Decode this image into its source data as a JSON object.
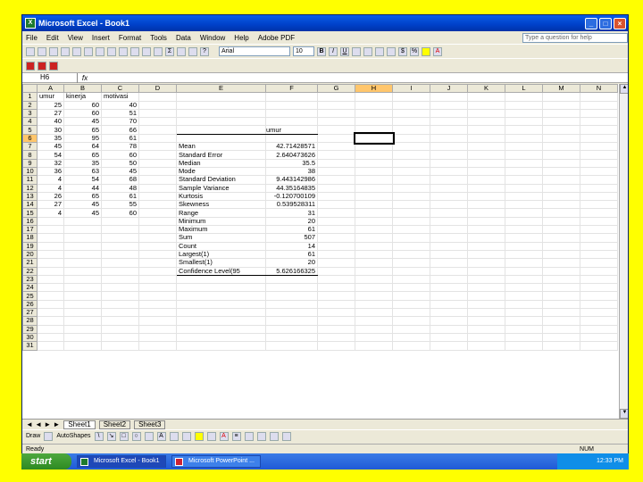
{
  "window": {
    "title": "Microsoft Excel - Book1"
  },
  "menu": [
    "File",
    "Edit",
    "View",
    "Insert",
    "Format",
    "Tools",
    "Data",
    "Window",
    "Help",
    "Adobe PDF"
  ],
  "help_placeholder": "Type a question for help",
  "font": {
    "name": "Arial",
    "size": "10"
  },
  "formula_bar": {
    "name_box": "H6",
    "fx": "fx",
    "value": ""
  },
  "columns": [
    "A",
    "B",
    "C",
    "D",
    "E",
    "F",
    "G",
    "H",
    "I",
    "J",
    "K",
    "L",
    "M",
    "N"
  ],
  "headers_row1": {
    "A": "umur",
    "B": "kinerja",
    "C": "motivasi"
  },
  "rows": [
    {
      "r": "2",
      "a": "25",
      "b": "60",
      "c": "40"
    },
    {
      "r": "3",
      "a": "27",
      "b": "60",
      "c": "51"
    },
    {
      "r": "4",
      "a": "40",
      "b": "45",
      "c": "70"
    },
    {
      "r": "5",
      "a": "30",
      "b": "65",
      "c": "66"
    },
    {
      "r": "6",
      "a": "35",
      "b": "95",
      "c": "61"
    },
    {
      "r": "7",
      "a": "45",
      "b": "64",
      "c": "78"
    },
    {
      "r": "8",
      "a": "54",
      "b": "65",
      "c": "60"
    },
    {
      "r": "9",
      "a": "32",
      "b": "35",
      "c": "50"
    },
    {
      "r": "10",
      "a": "36",
      "b": "63",
      "c": "45"
    },
    {
      "r": "11",
      "a": "4",
      "b": "54",
      "c": "68"
    },
    {
      "r": "12",
      "a": "4",
      "b": "44",
      "c": "48"
    },
    {
      "r": "13",
      "a": "26",
      "b": "65",
      "c": "61"
    },
    {
      "r": "14",
      "a": "27",
      "b": "45",
      "c": "55"
    },
    {
      "r": "15",
      "a": "4",
      "b": "45",
      "c": "60"
    }
  ],
  "extra_rows": [
    "16",
    "17",
    "18",
    "19",
    "20",
    "21",
    "22",
    "23",
    "24",
    "25",
    "26",
    "27",
    "28",
    "29",
    "30",
    "31"
  ],
  "descriptive": {
    "header": "umur",
    "stats": [
      {
        "label": "Mean",
        "value": "42.71428571"
      },
      {
        "label": "Standard Error",
        "value": "2.640473626"
      },
      {
        "label": "Median",
        "value": "35.5"
      },
      {
        "label": "Mode",
        "value": "38"
      },
      {
        "label": "Standard Deviation",
        "value": "9.443142986"
      },
      {
        "label": "Sample Variance",
        "value": "44.35164835"
      },
      {
        "label": "Kurtosis",
        "value": "-0.120700109"
      },
      {
        "label": "Skewness",
        "value": "0.539528311"
      },
      {
        "label": "Range",
        "value": "31"
      },
      {
        "label": "Minimum",
        "value": "20"
      },
      {
        "label": "Maximum",
        "value": "61"
      },
      {
        "label": "Sum",
        "value": "507"
      },
      {
        "label": "Count",
        "value": "14"
      },
      {
        "label": "Largest(1)",
        "value": "61"
      },
      {
        "label": "Smallest(1)",
        "value": "20"
      },
      {
        "label": "Confidence Level(95",
        "value": "5.626166325"
      }
    ]
  },
  "sheets": [
    "Sheet1",
    "Sheet2",
    "Sheet3"
  ],
  "draw": {
    "draw_label": "Draw",
    "autoshapes_label": "AutoShapes"
  },
  "status": {
    "left": "Ready",
    "right": "NUM"
  },
  "taskbar": {
    "start": "start",
    "tasks": [
      "Microsoft Excel - Book1",
      "Microsoft PowerPoint ..."
    ],
    "clock": "12:33 PM"
  }
}
